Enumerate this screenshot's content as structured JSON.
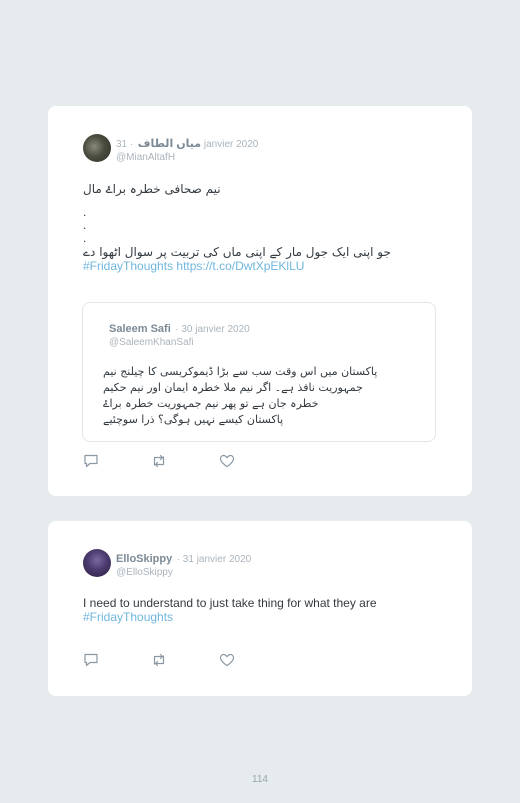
{
  "tweets": [
    {
      "display_name": "میاں الطاف",
      "date": "· 31 janvier 2020",
      "handle": "@MianAltafH",
      "lines": [
        "نیم صحافی خطرہ براۓ مال",
        ".",
        ".",
        ".",
        "جو اپنی ایک جول مار کے اپنی ماں کی تربیت پر سوال اٹھوا دے"
      ],
      "hashtag": "#FridayThoughts",
      "link": "https://t.co/DwtXpEKlLU",
      "quoted": {
        "display_name": "Saleem Safi",
        "date": "· 30 janvier 2020",
        "handle": "@SaleemKhanSafi",
        "lines": [
          "پاکستان میں اس وقت سب سے بڑا ڈیموکریسی کا چیلنج نیم",
          "جمہوریت نافذ ہے۔ اگر نیم ملا خطرہ ایمان اور نیم حکیم",
          "خطرہ جان ہے تو پھر نیم جمہوریت خطرہ براۓ",
          "پاکستان کیسے نہیں ہوگی؟ ذرا سوچئیے"
        ]
      }
    },
    {
      "display_name": "ElloSkippy",
      "date": "· 31 janvier 2020",
      "handle": "@ElloSkippy",
      "text": "I need to understand to just take thing for what they are",
      "hashtag": "#FridayThoughts"
    }
  ],
  "icons": [
    "reply-icon",
    "retweet-icon",
    "like-icon"
  ],
  "colors": {
    "link": "#6fb6de",
    "background": "#e6ebee",
    "card": "#ffffff"
  },
  "page_number": "114"
}
